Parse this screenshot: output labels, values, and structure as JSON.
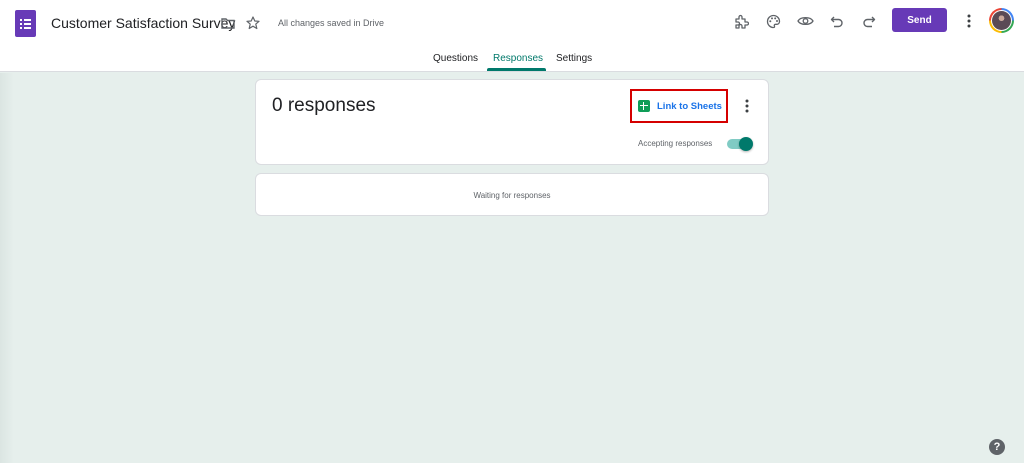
{
  "header": {
    "app_icon": "google-forms-icon",
    "doc_title": "Customer Satisfaction Survey",
    "folder_icon": "folder-icon",
    "star_icon": "star-icon",
    "saved_status": "All changes saved in Drive",
    "toolbar_icons": [
      "add-ons-icon",
      "palette-icon",
      "preview-eye-icon",
      "undo-icon",
      "redo-icon"
    ],
    "send_label": "Send",
    "more_icon": "more-vert-icon",
    "accent_color": "#673ab7"
  },
  "tabs": {
    "questions": "Questions",
    "responses": "Responses",
    "settings": "Settings",
    "active": "Responses",
    "active_color": "#00796b"
  },
  "responses": {
    "count_label": "0 responses",
    "link_to_sheets_label": "Link to Sheets",
    "accepting_label": "Accepting responses",
    "accepting_on": true,
    "waiting_label": "Waiting for responses"
  },
  "help": {
    "label": "?"
  }
}
